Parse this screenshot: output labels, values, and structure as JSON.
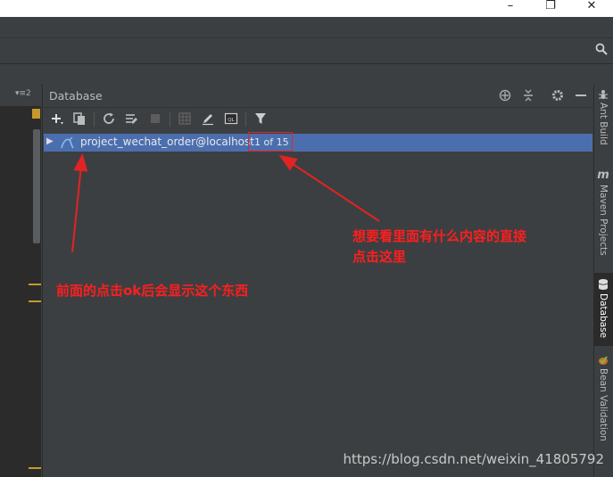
{
  "window": {
    "minimize_glyph": "–",
    "maximize_glyph": "❐",
    "close_glyph": "✕"
  },
  "editor": {
    "header_label": "▾≡2"
  },
  "database_panel": {
    "title": "Database",
    "toolbar_icons": [
      "plus-icon",
      "duplicate-icon",
      "refresh-icon",
      "schema-sync-icon",
      "stop-icon",
      "table-icon",
      "edit-icon",
      "sql-console-icon",
      "filter-icon"
    ],
    "tree": {
      "items": [
        {
          "label": "project_wechat_order@localhost",
          "count": "1 of 15",
          "selected": true
        }
      ]
    }
  },
  "right_tool_windows": [
    {
      "label": "Ant Build",
      "icon": "ant-icon"
    },
    {
      "label": "Maven Projects",
      "icon": "maven-icon",
      "icon_glyph": "m"
    },
    {
      "label": "Database",
      "icon": "database-icon",
      "active": true
    },
    {
      "label": "Bean Validation",
      "icon": "bean-validation-icon"
    }
  ],
  "annotations": {
    "left_note": "前面的点击ok后会显示这个东西",
    "right_note_line1": "想要看里面有什么内容的直接",
    "right_note_line2": "点击这里"
  },
  "watermark": "https://blog.csdn.net/weixin_41805792",
  "colors": {
    "selection": "#4b6eaf",
    "annotation": "#ff1e1e",
    "background": "#3c3f41",
    "editor": "#2b2b2b"
  }
}
